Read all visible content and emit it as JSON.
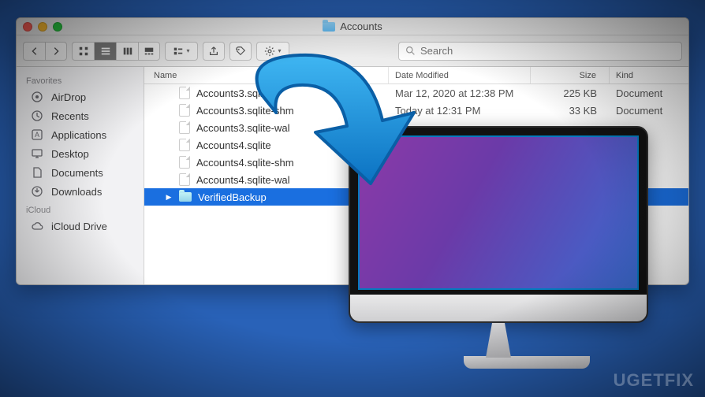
{
  "window": {
    "title": "Accounts"
  },
  "search": {
    "placeholder": "Search"
  },
  "sidebar": {
    "sections": [
      {
        "label": "Favorites",
        "items": [
          {
            "icon": "airdrop",
            "label": "AirDrop"
          },
          {
            "icon": "recents",
            "label": "Recents"
          },
          {
            "icon": "applications",
            "label": "Applications"
          },
          {
            "icon": "desktop",
            "label": "Desktop"
          },
          {
            "icon": "documents",
            "label": "Documents"
          },
          {
            "icon": "downloads",
            "label": "Downloads"
          }
        ]
      },
      {
        "label": "iCloud",
        "items": [
          {
            "icon": "icloud",
            "label": "iCloud Drive"
          }
        ]
      }
    ]
  },
  "columns": {
    "name": "Name",
    "date": "Date Modified",
    "size": "Size",
    "kind": "Kind"
  },
  "files": [
    {
      "type": "file",
      "name": "Accounts3.sqlite",
      "date": "Mar 12, 2020 at 12:38 PM",
      "size": "225 KB",
      "kind": "Document"
    },
    {
      "type": "file",
      "name": "Accounts3.sqlite-shm",
      "date": "Today at 12:31 PM",
      "size": "33 KB",
      "kind": "Document"
    },
    {
      "type": "file",
      "name": "Accounts3.sqlite-wal",
      "date": "",
      "size": "",
      "kind": ""
    },
    {
      "type": "file",
      "name": "Accounts4.sqlite",
      "date": "",
      "size": "",
      "kind": ""
    },
    {
      "type": "file",
      "name": "Accounts4.sqlite-shm",
      "date": "",
      "size": "",
      "kind": ""
    },
    {
      "type": "file",
      "name": "Accounts4.sqlite-wal",
      "date": "",
      "size": "",
      "kind": ""
    },
    {
      "type": "folder",
      "name": "VerifiedBackup",
      "date": "",
      "size": "",
      "kind": "",
      "selected": true
    }
  ],
  "watermark": "UGETFIX"
}
